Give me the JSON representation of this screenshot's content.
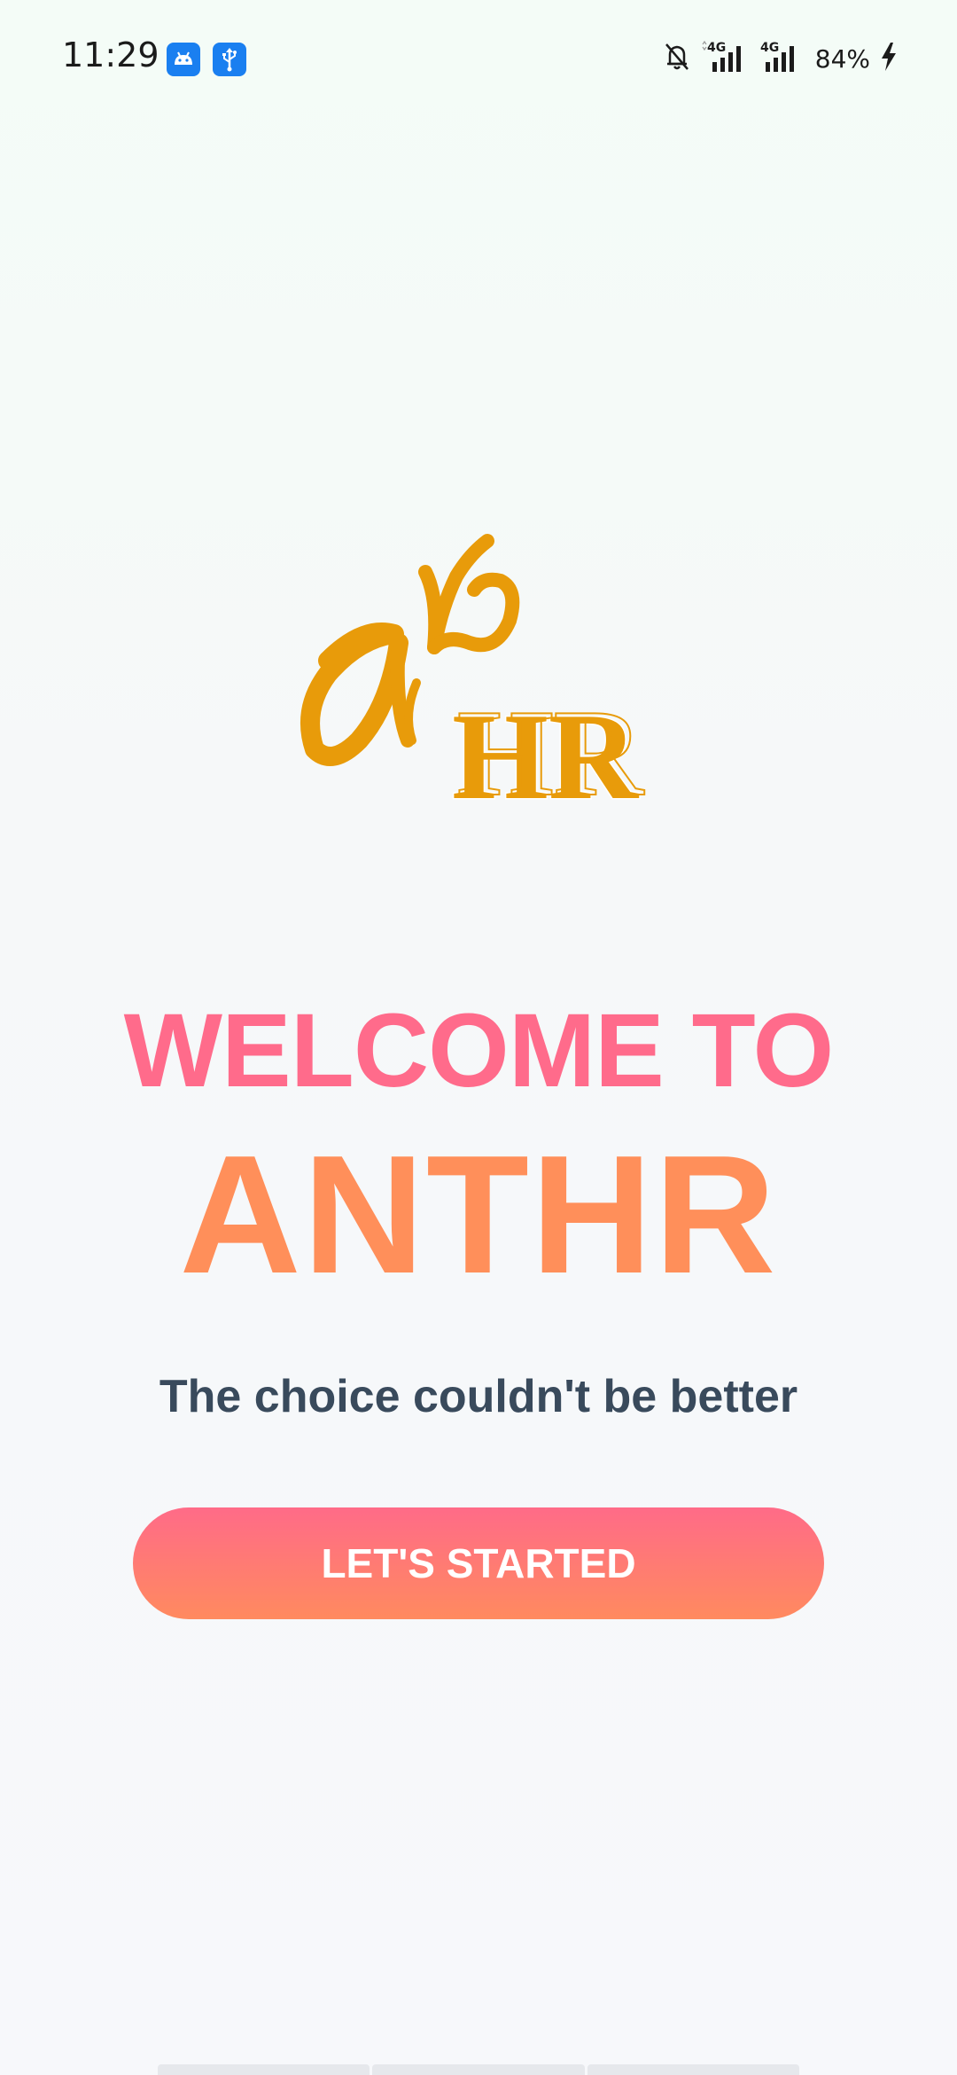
{
  "status_bar": {
    "time": "11:29",
    "notification_icons": [
      "android-icon",
      "usb-icon"
    ],
    "icons": [
      "mute-bell-icon",
      "signal-4g-icon",
      "signal-4g-icon",
      "charging-icon"
    ],
    "network_labels": [
      "4G",
      "4G"
    ],
    "battery": "84%"
  },
  "logo": {
    "alt": "ANTHR logo",
    "text": "HR",
    "color": "#e89b0a"
  },
  "welcome": {
    "line1": "WELCOME TO",
    "line2": "ANTHR",
    "tagline": "The choice couldn't be better"
  },
  "actions": {
    "start_label": "LET'S STARTED"
  },
  "colors": {
    "welcome": "#ff6b8b",
    "brand": "#ff8f5a",
    "tagline": "#394a5c",
    "button_top": "#ff6b88",
    "button_bottom": "#ff8a5f"
  }
}
